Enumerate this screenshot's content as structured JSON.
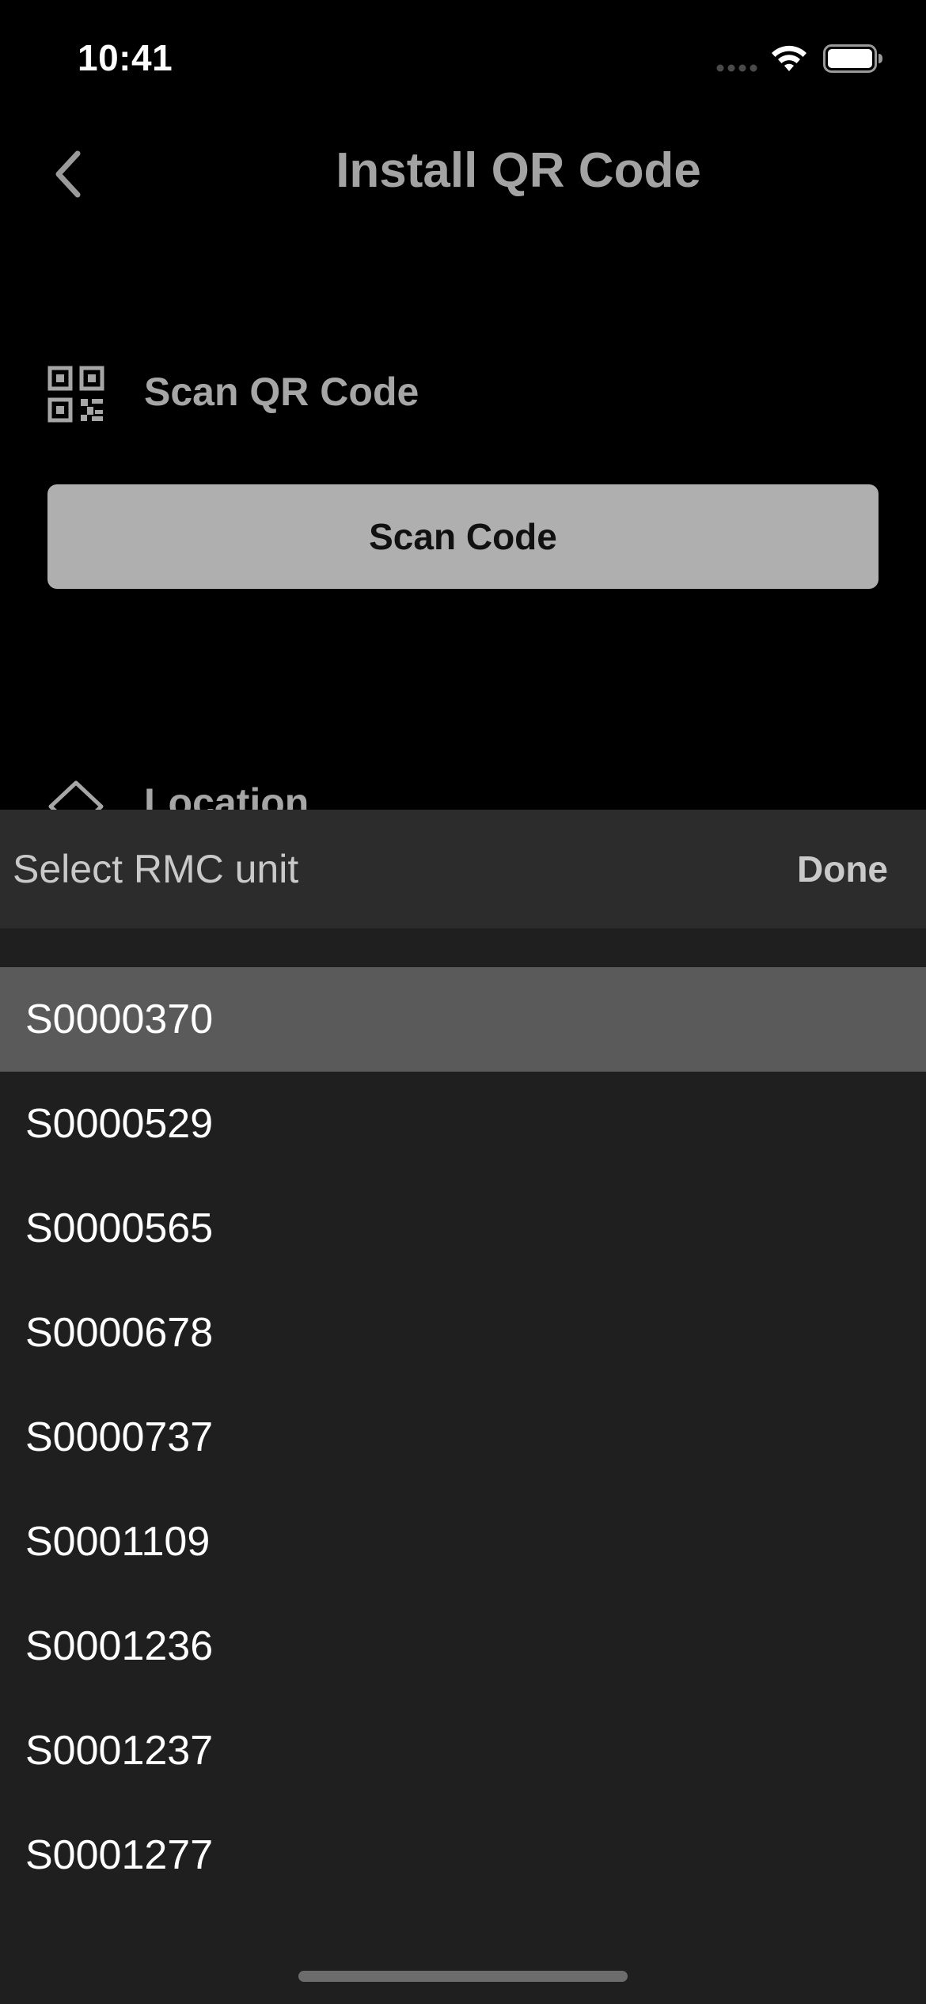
{
  "status_bar": {
    "time": "10:41"
  },
  "nav": {
    "title": "Install QR Code",
    "back_icon": "chevron-left-icon"
  },
  "scan": {
    "label": "Scan QR Code",
    "icon": "qr-code-icon",
    "button_label": "Scan Code"
  },
  "location": {
    "label": "Location",
    "icon": "location-icon"
  },
  "picker": {
    "title": "Select RMC unit",
    "done_label": "Done",
    "selected_index": 0,
    "items": [
      {
        "label": "S0000370"
      },
      {
        "label": "S0000529"
      },
      {
        "label": "S0000565"
      },
      {
        "label": "S0000678"
      },
      {
        "label": "S0000737"
      },
      {
        "label": "S0001109"
      },
      {
        "label": "S0001236"
      },
      {
        "label": "S0001237"
      },
      {
        "label": "S0001277"
      }
    ]
  },
  "colors": {
    "background": "#000000",
    "sheet": "#1f1f1f",
    "toolbar": "#2c2c2c",
    "selected_row": "#5a5a5a",
    "button": "#afafaf"
  }
}
